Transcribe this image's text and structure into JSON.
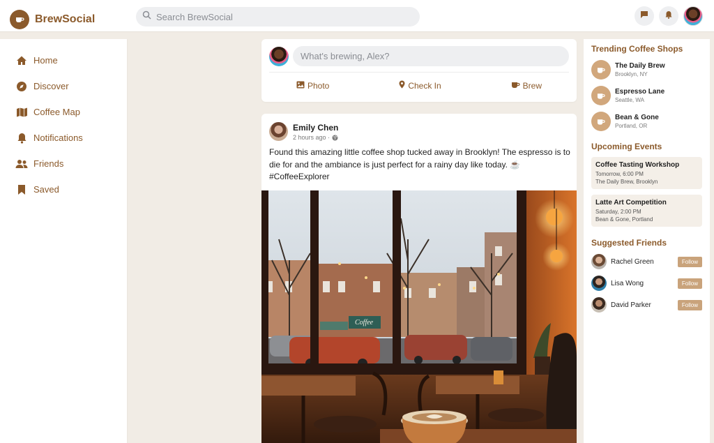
{
  "brand": {
    "name": "BrewSocial"
  },
  "search": {
    "placeholder": "Search BrewSocial"
  },
  "sidebar": {
    "items": [
      {
        "label": "Home",
        "icon": "home-icon"
      },
      {
        "label": "Discover",
        "icon": "compass-icon"
      },
      {
        "label": "Coffee Map",
        "icon": "map-icon"
      },
      {
        "label": "Notifications",
        "icon": "bell-icon"
      },
      {
        "label": "Friends",
        "icon": "users-icon"
      },
      {
        "label": "Saved",
        "icon": "bookmark-icon"
      }
    ]
  },
  "composer": {
    "placeholder": "What's brewing, Alex?",
    "actions": {
      "photo": "Photo",
      "checkin": "Check In",
      "brew": "Brew"
    }
  },
  "post": {
    "author": "Emily Chen",
    "time": "2 hours ago ·",
    "text": "Found this amazing little coffee shop tucked away in Brooklyn! The espresso is to die for and the ambiance is just perfect for a rainy day like today. ☕ #CoffeeExplorer",
    "photo_sign": "Coffee"
  },
  "trending": {
    "title": "Trending Coffee Shops",
    "shops": [
      {
        "name": "The Daily Brew",
        "location": "Brooklyn, NY"
      },
      {
        "name": "Espresso Lane",
        "location": "Seattle, WA"
      },
      {
        "name": "Bean & Gone",
        "location": "Portland, OR"
      }
    ]
  },
  "events": {
    "title": "Upcoming Events",
    "items": [
      {
        "title": "Coffee Tasting Workshop",
        "when": "Tomorrow, 6:00 PM",
        "where": "The Daily Brew, Brooklyn"
      },
      {
        "title": "Latte Art Competition",
        "when": "Saturday, 2:00 PM",
        "where": "Bean & Gone, Portland"
      }
    ]
  },
  "friends": {
    "title": "Suggested Friends",
    "follow_label": "Follow",
    "people": [
      {
        "name": "Rachel Green"
      },
      {
        "name": "Lisa Wong"
      },
      {
        "name": "David Parker"
      }
    ]
  },
  "colors": {
    "brand": "#8b5a2b",
    "accent": "#c9a37b",
    "background": "#f1ece5"
  }
}
